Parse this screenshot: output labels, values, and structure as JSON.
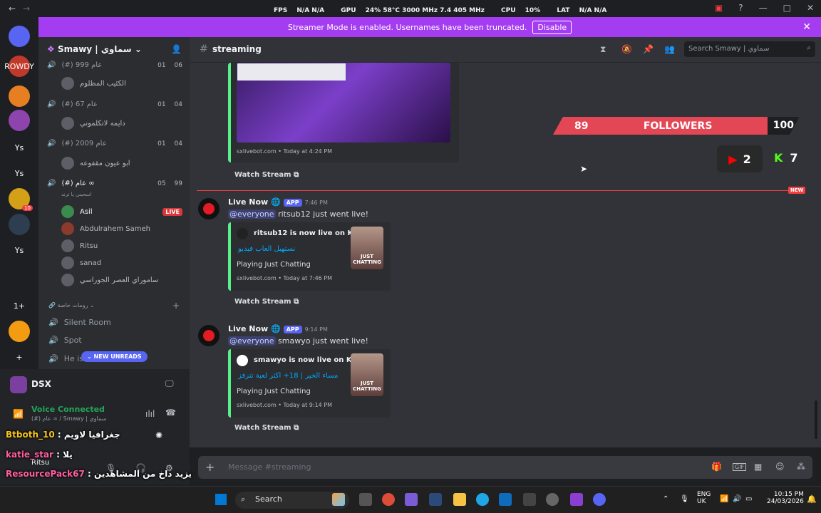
{
  "titlebar": {
    "back": "←",
    "forward": "→",
    "perf": [
      {
        "label": "FPS",
        "value": "N/A N/A"
      },
      {
        "label": "GPU",
        "value": "24% 58°C 3000 MHz 7.4 405 MHz"
      },
      {
        "label": "CPU",
        "value": "10%"
      },
      {
        "label": "LAT",
        "value": "N/A N/A"
      }
    ],
    "window_title": "Smawy | سماوي"
  },
  "banner": {
    "text": "Streamer Mode is enabled. Usernames have been truncated.",
    "disable_label": "Disable"
  },
  "servers": [
    {
      "label": "",
      "color": "#5865f2"
    },
    {
      "label": "ROWDY",
      "color": "#c0392b"
    },
    {
      "label": "",
      "color": "#e67e22"
    },
    {
      "label": "",
      "color": "#8e44ad"
    },
    {
      "label": "Ys",
      "color": "transparent"
    },
    {
      "label": "Ys",
      "color": "transparent"
    },
    {
      "label": "",
      "color": "#d4a017",
      "badge": "10"
    },
    {
      "label": "",
      "color": "#2c3e50"
    },
    {
      "label": "Ys",
      "color": "transparent"
    },
    {
      "label": "",
      "color": "transparent"
    },
    {
      "label": "1+",
      "color": "transparent"
    },
    {
      "label": "",
      "color": "#f39c12"
    },
    {
      "label": "+",
      "color": "transparent"
    }
  ],
  "sidebar": {
    "server_name": "Smawy | سماوي",
    "voice_channels": [
      {
        "name": "(#) عام 999",
        "count_a": "01",
        "count_b": "06",
        "members": [
          "الكئيب المظلوم"
        ]
      },
      {
        "name": "(#) عام 67",
        "count_a": "01",
        "count_b": "04",
        "members": [
          "دايمه لاتكلموني"
        ]
      },
      {
        "name": "(#) عام 2009",
        "count_a": "01",
        "count_b": "04",
        "members": [
          "ابو عيون مقفوعه"
        ]
      },
      {
        "name": "(#) عام ∞",
        "count_a": "05",
        "count_b": "99",
        "members": []
      }
    ],
    "voice_sub": "اسحبني يا ترند",
    "live_members": [
      {
        "name": "Asil",
        "live": "LIVE"
      },
      {
        "name": "Abdulrahem Sameh"
      },
      {
        "name": "Ritsu"
      },
      {
        "name": "sanad"
      },
      {
        "name": "ساموراي العصر الجوراسي"
      }
    ],
    "category": "رومات خاصة",
    "text_channels": [
      "Silent Room",
      "Spot",
      "He is"
    ],
    "new_unreads": "NEW UNREADS"
  },
  "user_panel": {
    "dsx": "DSX",
    "voice_status": "Voice Connected",
    "voice_channel": "(#) عام ∞ / Smawy | سماوي",
    "username": "Ritsu"
  },
  "overlay_chat": [
    {
      "user": "Btboth_10",
      "text": ": جغرافيا لاويم",
      "color": "#f5c518"
    },
    {
      "user": "katie_star",
      "text": ": يلا",
      "color": "#ff5fa2"
    },
    {
      "user": "ResourcePack67",
      "text": ": يزيد داخ من المشاهدين",
      "color": "#ff5fa2"
    }
  ],
  "channel": {
    "name": "streaming",
    "search_placeholder": "Search Smawy | سماوي"
  },
  "messages": [
    {
      "footer": "sxlivebot.com • Today at 4:24 PM",
      "watch": "Watch Stream"
    },
    {
      "author": "Live Now",
      "tag": "APP",
      "time": "7:46 PM",
      "mention": "@everyone",
      "text": "ritsub12 just went live!",
      "embed_title": "ritsub12 is now live on Kick!",
      "embed_link": "نستهبل العاب فيديو",
      "embed_sub": "Playing Just Chatting",
      "embed_footer": "sxlivebot.com • Today at 7:46 PM",
      "thumb": "JUST CHATTING",
      "watch": "Watch Stream",
      "new": "NEW"
    },
    {
      "author": "Live Now",
      "tag": "APP",
      "time": "9:14 PM",
      "mention": "@everyone",
      "text": "smawyo just went live!",
      "embed_title": "smawyo is now live on Kick!",
      "embed_link": "مساء الخير | 18+ اكثر لعبة تترفز",
      "embed_sub": "Playing Just Chatting",
      "embed_footer": "sxlivebot.com • Today at 9:14 PM",
      "thumb": "JUST CHATTING",
      "watch": "Watch Stream"
    }
  ],
  "stream_overlay": {
    "followers_label": "FOLLOWERS",
    "followers_current": "89",
    "followers_goal": "100",
    "youtube_count": "2",
    "kick_count": "7"
  },
  "composer": {
    "placeholder": "Message #streaming"
  },
  "taskbar": {
    "search": "Search",
    "lang": "ENG",
    "region": "UK",
    "time": "10:15 PM",
    "date": "24/03/2026"
  }
}
